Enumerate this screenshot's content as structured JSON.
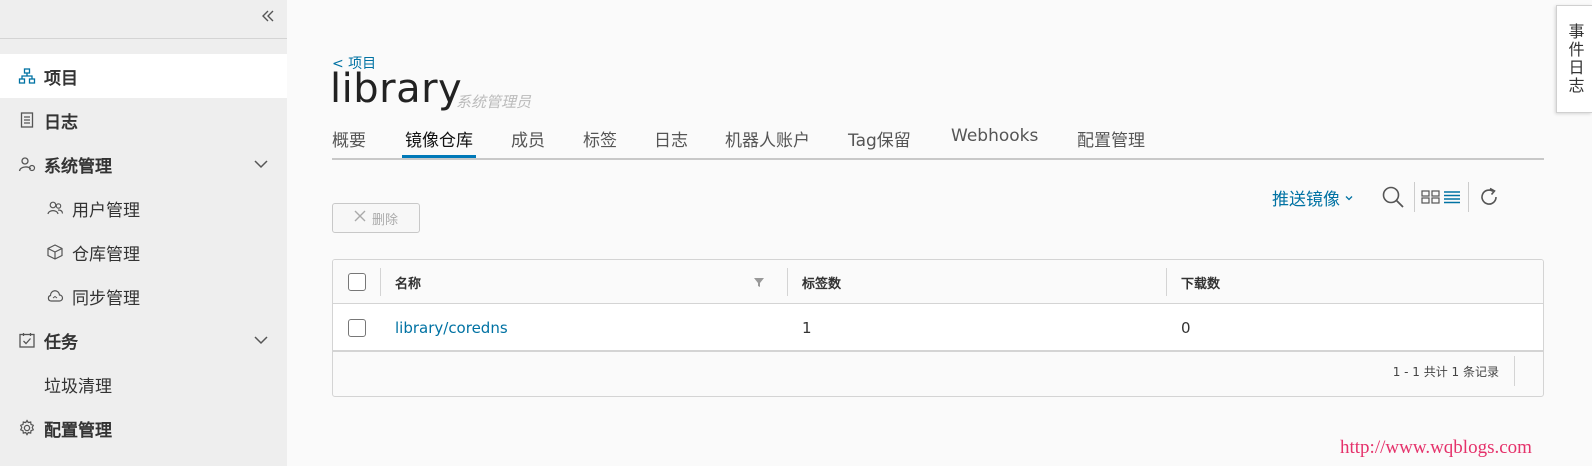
{
  "sidebar": {
    "items": [
      {
        "label": "项目",
        "icon": "project-icon"
      },
      {
        "label": "日志",
        "icon": "log-icon"
      },
      {
        "label": "系统管理",
        "icon": "admin-icon"
      },
      {
        "label": "用户管理",
        "icon": "users-icon"
      },
      {
        "label": "仓库管理",
        "icon": "box-icon"
      },
      {
        "label": "同步管理",
        "icon": "cloud-sync-icon"
      },
      {
        "label": "任务",
        "icon": "calendar-check-icon"
      },
      {
        "label": "垃圾清理",
        "icon": ""
      },
      {
        "label": "配置管理",
        "icon": "gear-icon"
      }
    ]
  },
  "header": {
    "breadcrumb": "< 项目",
    "title": "library",
    "role": "系统管理员"
  },
  "tabs": [
    {
      "label": "概要"
    },
    {
      "label": "镜像仓库"
    },
    {
      "label": "成员"
    },
    {
      "label": "标签"
    },
    {
      "label": "日志"
    },
    {
      "label": "机器人账户"
    },
    {
      "label": "Tag保留"
    },
    {
      "label": "Webhooks"
    },
    {
      "label": "配置管理"
    }
  ],
  "toolbar": {
    "push_label": "推送镜像",
    "delete_label": "删除"
  },
  "table": {
    "columns": [
      "名称",
      "标签数",
      "下载数"
    ],
    "rows": [
      {
        "name": "library/coredns",
        "tags": "1",
        "downloads": "0"
      }
    ],
    "footer": "1 - 1 共计 1 条记录"
  },
  "event_log_label": "事件日志",
  "watermark": "http://www.wqblogs.com",
  "colors": {
    "accent": "#0079b8",
    "link": "#0072a3",
    "sidebar_bg": "#eeeeee"
  }
}
